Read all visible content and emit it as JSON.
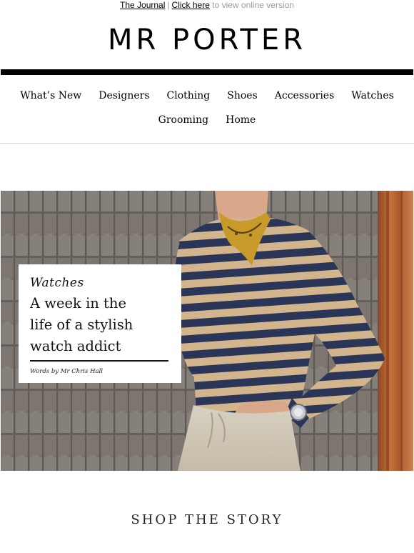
{
  "preheader": {
    "journal_link": "The Journal",
    "separator": "|",
    "click_link": "Click here",
    "trailing_text": "to view online version"
  },
  "brand": {
    "logo_text": "MR PORTER"
  },
  "nav": {
    "row1": [
      "What’s New",
      "Designers",
      "Clothing",
      "Shoes",
      "Accessories",
      "Watches"
    ],
    "row2": [
      "Grooming",
      "Home"
    ]
  },
  "hero": {
    "image_subject": "Man in navy and tan striped sweater with neckerchief and wristwatch against a brick wall",
    "card": {
      "category": "Watches",
      "title_lines": [
        "A week in the",
        "life of a stylish",
        "watch addict"
      ],
      "credit": "Words by Mr Chris Hall"
    }
  },
  "section": {
    "shop_title": "SHOP THE STORY"
  },
  "colors": {
    "text": "#000000",
    "muted": "#9b9b9b",
    "wall": "#8a8480",
    "stripe_navy": "#2b3557",
    "stripe_tan": "#d2b58c",
    "scarf": "#c79a2a",
    "rust_panel": "#b4622f"
  }
}
